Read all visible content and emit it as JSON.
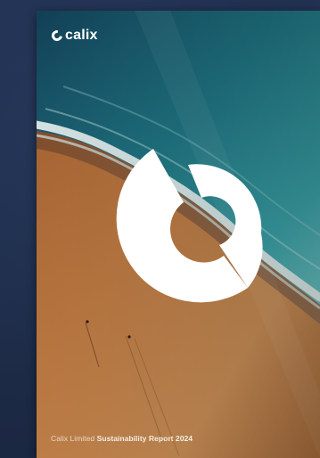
{
  "brand": {
    "logo_text": "calix",
    "logo_icon": "calix-c-mark-icon"
  },
  "footer": {
    "company": "Calix Limited",
    "title": "Sustainability Report 2024"
  },
  "colors": {
    "page_background": "#1e2c48",
    "ocean_deep": "#0f4f5f",
    "ocean_teal": "#2a8d97",
    "sand": "#b8763f",
    "emblem": "#ffffff"
  }
}
